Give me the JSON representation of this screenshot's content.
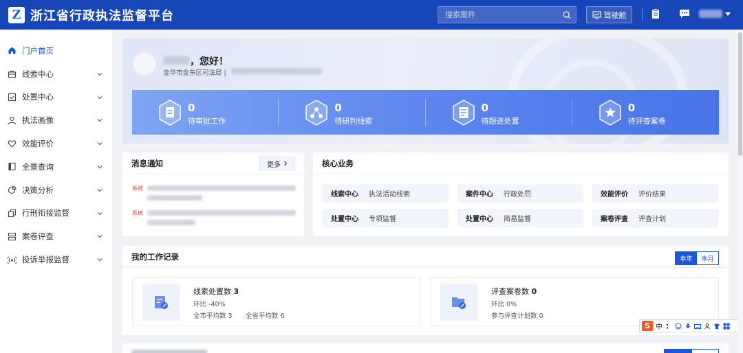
{
  "header": {
    "logo_letter": "Z",
    "title": "浙江省行政执法监督平台",
    "search_placeholder": "搜索案件",
    "cockpit_label": "驾驶舱"
  },
  "sidebar": {
    "items": [
      {
        "label": "门户首页",
        "icon": "home-icon",
        "active": true
      },
      {
        "label": "线索中心",
        "icon": "briefcase-icon"
      },
      {
        "label": "处置中心",
        "icon": "checkbox-icon"
      },
      {
        "label": "执法画像",
        "icon": "user-icon"
      },
      {
        "label": "效能评价",
        "icon": "heart-icon"
      },
      {
        "label": "全景查询",
        "icon": "book-icon"
      },
      {
        "label": "决策分析",
        "icon": "pie-icon"
      },
      {
        "label": "行刑衔接监督",
        "icon": "copy-icon"
      },
      {
        "label": "案卷评查",
        "icon": "stack-icon"
      },
      {
        "label": "投诉举报监督",
        "icon": "broadcast-icon"
      }
    ]
  },
  "welcome": {
    "greeting": "，您好！",
    "org": "金华市金东区司法局 |"
  },
  "stats": [
    {
      "value": "0",
      "label": "待审批工作",
      "icon": "shield-doc-icon"
    },
    {
      "value": "0",
      "label": "待研判线索",
      "icon": "network-icon"
    },
    {
      "value": "0",
      "label": "待跟进处置",
      "icon": "list-icon"
    },
    {
      "value": "0",
      "label": "待评查案卷",
      "icon": "star-icon"
    }
  ],
  "notices": {
    "title": "消息通知",
    "more_label": "更多",
    "items": [
      {
        "tag": "系统"
      },
      {
        "tag": "系统"
      }
    ]
  },
  "core_business": {
    "title": "核心业务",
    "items": [
      {
        "key": "线索中心",
        "value": "执法活动线索"
      },
      {
        "key": "案件中心",
        "value": "行政处罚"
      },
      {
        "key": "效能评价",
        "value": "评价结果"
      },
      {
        "key": "处置中心",
        "value": "专项监督"
      },
      {
        "key": "处置中心",
        "value": "简易监督"
      },
      {
        "key": "案卷评查",
        "value": "评查计划"
      }
    ]
  },
  "work_record": {
    "title": "我的工作记录",
    "tab_year": "本年",
    "tab_month": "本月",
    "cards": [
      {
        "title": "线索处置数",
        "count": "3",
        "ratio": "环比 -40%",
        "city_avg": "全市平均数 3",
        "province_avg": "全省平均数 6"
      },
      {
        "title": "评查案卷数",
        "count": "0",
        "ratio": "环比 0%",
        "plans": "参与评查计划数 0"
      }
    ]
  },
  "ime": {
    "logo": "S",
    "mode": "中"
  },
  "colors": {
    "primary": "#1746b8",
    "accent": "#1a56db",
    "stat_band_start": "#7ea4f4",
    "stat_band_end": "#4774e8"
  }
}
